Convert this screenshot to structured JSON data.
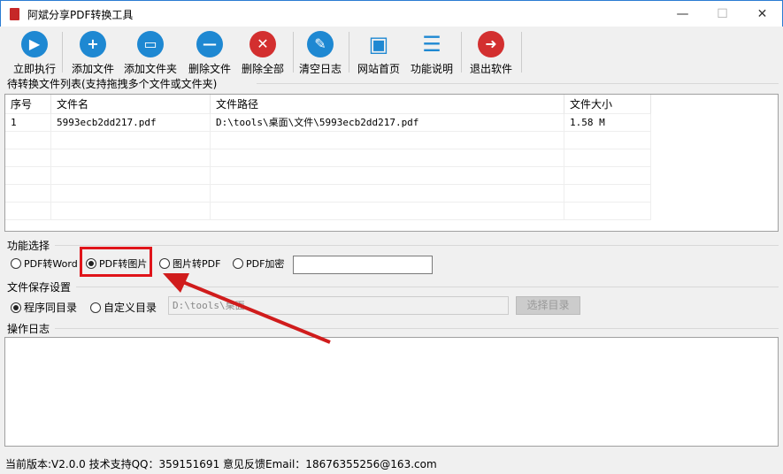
{
  "window": {
    "title": "阿斌分享PDF转换工具",
    "minimize": "—",
    "maximize": "☐",
    "close": "✕"
  },
  "toolbar": [
    {
      "label": "立即执行",
      "icon": "play-icon",
      "glyph": "▶",
      "color": "#1e88d2"
    },
    {
      "label": "添加文件",
      "icon": "plus-icon",
      "glyph": "+",
      "color": "#1e88d2"
    },
    {
      "label": "添加文件夹",
      "icon": "folder-icon",
      "glyph": "▭",
      "color": "#1e88d2"
    },
    {
      "label": "删除文件",
      "icon": "minus-icon",
      "glyph": "—",
      "color": "#1e88d2"
    },
    {
      "label": "删除全部",
      "icon": "close-circle-icon",
      "glyph": "✕",
      "color": "#d32f2f"
    },
    {
      "label": "清空日志",
      "icon": "broom-icon",
      "glyph": "✎",
      "color": "#1e88d2"
    },
    {
      "label": "网站首页",
      "icon": "monitor-icon",
      "glyph": "▣",
      "color": "#1e88d2"
    },
    {
      "label": "功能说明",
      "icon": "document-icon",
      "glyph": "☰",
      "color": "#1e88d2"
    },
    {
      "label": "退出软件",
      "icon": "exit-icon",
      "glyph": "➜",
      "color": "#d32f2f"
    }
  ],
  "file_list": {
    "title": "待转换文件列表(支持拖拽多个文件或文件夹)",
    "columns": [
      "序号",
      "文件名",
      "文件路径",
      "文件大小"
    ],
    "rows": [
      [
        "1",
        "5993ecb2dd217.pdf",
        "D:\\tools\\桌面\\文件\\5993ecb2dd217.pdf",
        "1.58 M"
      ]
    ]
  },
  "function": {
    "title": "功能选择",
    "options": [
      "PDF转Word",
      "PDF转图片",
      "图片转PDF",
      "PDF加密"
    ],
    "selected": "PDF转图片",
    "password": ""
  },
  "save": {
    "title": "文件保存设置",
    "options": [
      "程序同目录",
      "自定义目录"
    ],
    "selected": "程序同目录",
    "path": "D:\\tools\\桌面",
    "choose_button": "选择目录"
  },
  "log": {
    "title": "操作日志"
  },
  "status": "当前版本:V2.0.0  技术支持QQ：359151691  意见反馈Email：18676355256@163.com"
}
